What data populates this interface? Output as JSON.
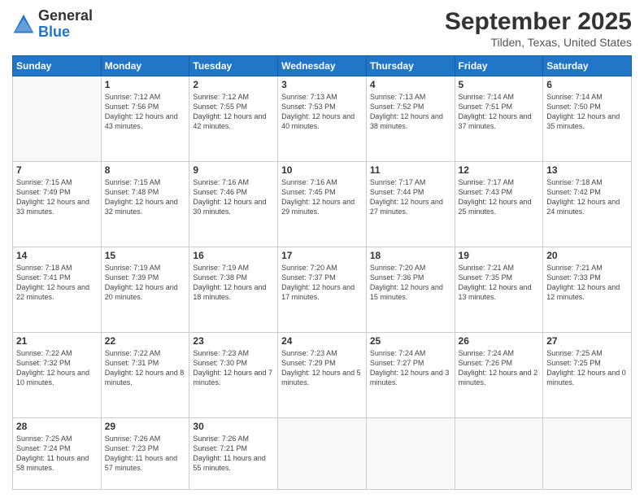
{
  "logo": {
    "general": "General",
    "blue": "Blue"
  },
  "title": "September 2025",
  "location": "Tilden, Texas, United States",
  "days_of_week": [
    "Sunday",
    "Monday",
    "Tuesday",
    "Wednesday",
    "Thursday",
    "Friday",
    "Saturday"
  ],
  "weeks": [
    [
      {
        "day": "",
        "empty": true
      },
      {
        "day": "1",
        "sunrise": "7:12 AM",
        "sunset": "7:56 PM",
        "daylight": "12 hours and 43 minutes."
      },
      {
        "day": "2",
        "sunrise": "7:12 AM",
        "sunset": "7:55 PM",
        "daylight": "12 hours and 42 minutes."
      },
      {
        "day": "3",
        "sunrise": "7:13 AM",
        "sunset": "7:53 PM",
        "daylight": "12 hours and 40 minutes."
      },
      {
        "day": "4",
        "sunrise": "7:13 AM",
        "sunset": "7:52 PM",
        "daylight": "12 hours and 38 minutes."
      },
      {
        "day": "5",
        "sunrise": "7:14 AM",
        "sunset": "7:51 PM",
        "daylight": "12 hours and 37 minutes."
      },
      {
        "day": "6",
        "sunrise": "7:14 AM",
        "sunset": "7:50 PM",
        "daylight": "12 hours and 35 minutes."
      }
    ],
    [
      {
        "day": "7",
        "sunrise": "7:15 AM",
        "sunset": "7:49 PM",
        "daylight": "12 hours and 33 minutes."
      },
      {
        "day": "8",
        "sunrise": "7:15 AM",
        "sunset": "7:48 PM",
        "daylight": "12 hours and 32 minutes."
      },
      {
        "day": "9",
        "sunrise": "7:16 AM",
        "sunset": "7:46 PM",
        "daylight": "12 hours and 30 minutes."
      },
      {
        "day": "10",
        "sunrise": "7:16 AM",
        "sunset": "7:45 PM",
        "daylight": "12 hours and 29 minutes."
      },
      {
        "day": "11",
        "sunrise": "7:17 AM",
        "sunset": "7:44 PM",
        "daylight": "12 hours and 27 minutes."
      },
      {
        "day": "12",
        "sunrise": "7:17 AM",
        "sunset": "7:43 PM",
        "daylight": "12 hours and 25 minutes."
      },
      {
        "day": "13",
        "sunrise": "7:18 AM",
        "sunset": "7:42 PM",
        "daylight": "12 hours and 24 minutes."
      }
    ],
    [
      {
        "day": "14",
        "sunrise": "7:18 AM",
        "sunset": "7:41 PM",
        "daylight": "12 hours and 22 minutes."
      },
      {
        "day": "15",
        "sunrise": "7:19 AM",
        "sunset": "7:39 PM",
        "daylight": "12 hours and 20 minutes."
      },
      {
        "day": "16",
        "sunrise": "7:19 AM",
        "sunset": "7:38 PM",
        "daylight": "12 hours and 18 minutes."
      },
      {
        "day": "17",
        "sunrise": "7:20 AM",
        "sunset": "7:37 PM",
        "daylight": "12 hours and 17 minutes."
      },
      {
        "day": "18",
        "sunrise": "7:20 AM",
        "sunset": "7:36 PM",
        "daylight": "12 hours and 15 minutes."
      },
      {
        "day": "19",
        "sunrise": "7:21 AM",
        "sunset": "7:35 PM",
        "daylight": "12 hours and 13 minutes."
      },
      {
        "day": "20",
        "sunrise": "7:21 AM",
        "sunset": "7:33 PM",
        "daylight": "12 hours and 12 minutes."
      }
    ],
    [
      {
        "day": "21",
        "sunrise": "7:22 AM",
        "sunset": "7:32 PM",
        "daylight": "12 hours and 10 minutes."
      },
      {
        "day": "22",
        "sunrise": "7:22 AM",
        "sunset": "7:31 PM",
        "daylight": "12 hours and 8 minutes."
      },
      {
        "day": "23",
        "sunrise": "7:23 AM",
        "sunset": "7:30 PM",
        "daylight": "12 hours and 7 minutes."
      },
      {
        "day": "24",
        "sunrise": "7:23 AM",
        "sunset": "7:29 PM",
        "daylight": "12 hours and 5 minutes."
      },
      {
        "day": "25",
        "sunrise": "7:24 AM",
        "sunset": "7:27 PM",
        "daylight": "12 hours and 3 minutes."
      },
      {
        "day": "26",
        "sunrise": "7:24 AM",
        "sunset": "7:26 PM",
        "daylight": "12 hours and 2 minutes."
      },
      {
        "day": "27",
        "sunrise": "7:25 AM",
        "sunset": "7:25 PM",
        "daylight": "12 hours and 0 minutes."
      }
    ],
    [
      {
        "day": "28",
        "sunrise": "7:25 AM",
        "sunset": "7:24 PM",
        "daylight": "11 hours and 58 minutes."
      },
      {
        "day": "29",
        "sunrise": "7:26 AM",
        "sunset": "7:23 PM",
        "daylight": "11 hours and 57 minutes."
      },
      {
        "day": "30",
        "sunrise": "7:26 AM",
        "sunset": "7:21 PM",
        "daylight": "11 hours and 55 minutes."
      },
      {
        "day": "",
        "empty": true
      },
      {
        "day": "",
        "empty": true
      },
      {
        "day": "",
        "empty": true
      },
      {
        "day": "",
        "empty": true
      }
    ]
  ]
}
